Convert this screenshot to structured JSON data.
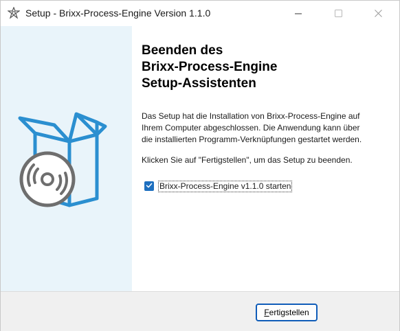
{
  "window": {
    "title": "Setup - Brixx-Process-Engine Version 1.1.0"
  },
  "icons": {
    "app": "setup-gear-icon",
    "minimize": "minimize-icon",
    "maximize": "maximize-icon",
    "close": "close-icon",
    "illustration": "software-box-cd-icon",
    "checkbox": "checkmark-icon"
  },
  "wizard": {
    "heading_lines": [
      "Beenden des",
      "Brixx-Process-Engine",
      "Setup-Assistenten"
    ],
    "paragraph1_lines": [
      "Das Setup hat die Installation von Brixx-Process-Engine auf",
      "Ihrem Computer abgeschlossen. Die Anwendung kann über",
      "die installierten Programm-Verknüpfungen gestartet werden."
    ],
    "paragraph2": "Klicken Sie auf \"Fertigstellen\", um das Setup zu beenden.",
    "launch_checkbox": {
      "label": "Brixx-Process-Engine v1.1.0 starten",
      "checked": true
    }
  },
  "footer": {
    "finish_label": "Fertigstellen"
  },
  "colors": {
    "side_panel_bg": "#e9f4fa",
    "accent_blue": "#1d6fbf",
    "box_blue": "#2b8fd0",
    "disc_gray": "#6e6e6e"
  }
}
